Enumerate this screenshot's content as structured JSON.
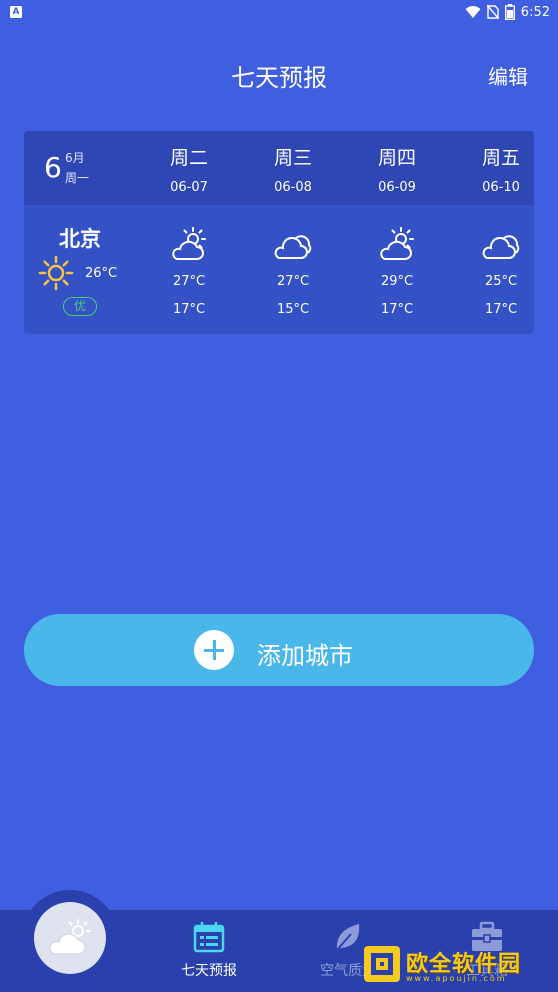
{
  "status_bar": {
    "time": "6:52",
    "app_icon": "A"
  },
  "header": {
    "title": "七天预报",
    "edit_label": "编辑"
  },
  "today": {
    "day": "6",
    "month": "6月",
    "weekday": "周一"
  },
  "forecast": [
    {
      "day": "周二",
      "date": "06-07",
      "icon": "partly-sunny-icon",
      "high": "27°C",
      "low": "17°C"
    },
    {
      "day": "周三",
      "date": "06-08",
      "icon": "cloudy-icon",
      "high": "27°C",
      "low": "15°C"
    },
    {
      "day": "周四",
      "date": "06-09",
      "icon": "partly-sunny-icon",
      "high": "29°C",
      "low": "17°C"
    },
    {
      "day": "周五",
      "date": "06-10",
      "icon": "cloudy-icon",
      "high": "25°C",
      "low": "17°C"
    }
  ],
  "city": {
    "name": "北京",
    "current_temp": "26°C",
    "aqi_label": "优",
    "icon": "sun-icon"
  },
  "add_city": {
    "label": "添加城市"
  },
  "nav": {
    "items": [
      {
        "label": "七天预报",
        "icon": "calendar-icon",
        "active": true
      },
      {
        "label": "空气质量",
        "icon": "leaf-icon",
        "active": false
      },
      {
        "label": "工具箱",
        "icon": "toolbox-icon",
        "active": false
      }
    ],
    "fab_icon": "cloud-sun-icon"
  },
  "watermark": {
    "text": "欧全软件园",
    "url": "www.apoujin.com"
  },
  "colors": {
    "background": "#3f5ee0",
    "card": "#3451c6",
    "card_header": "#2f47b5",
    "accent_button": "#4ab7ea",
    "aqi_good": "#3ecf7e",
    "nav_bar": "#2940ad",
    "sun": "#f5c542"
  }
}
